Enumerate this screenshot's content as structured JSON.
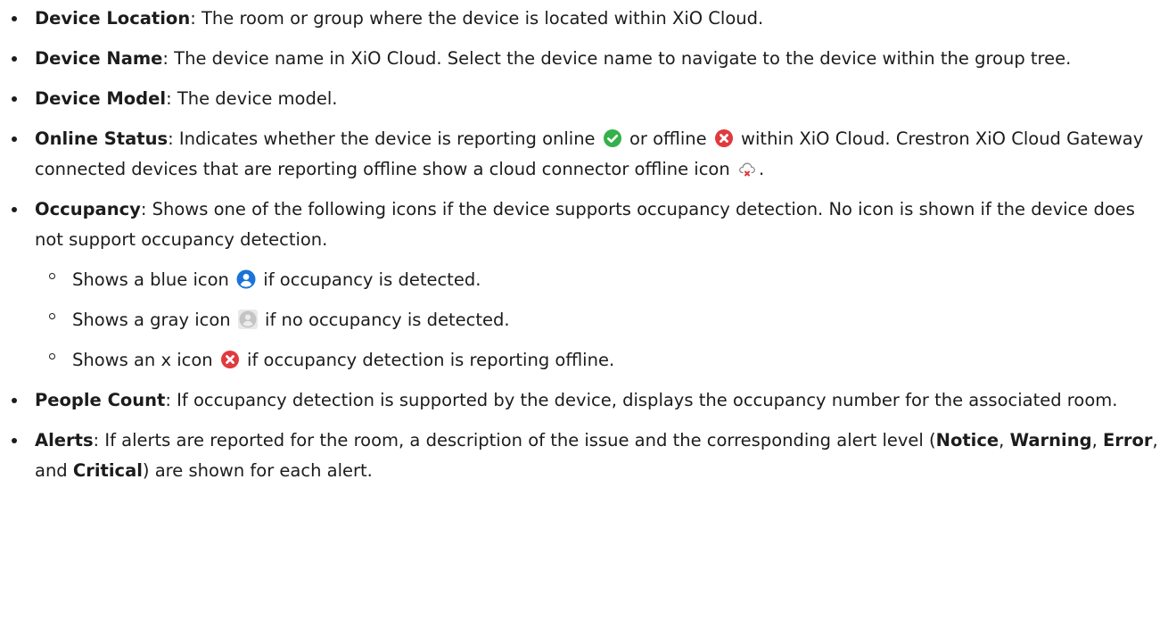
{
  "items": [
    {
      "term": "Device Location",
      "text": ": The room or group where the device is located within XiO Cloud."
    },
    {
      "term": "Device Name",
      "text": ": The device name in XiO Cloud. Select the device name to navigate to the device within the group tree."
    },
    {
      "term": "Device Model",
      "text": ": The device model."
    }
  ],
  "online_status": {
    "term": "Online Status",
    "text_a": ": Indicates whether the device is reporting online ",
    "text_b": " or offline ",
    "text_c": " within XiO Cloud. Crestron XiO Cloud Gateway connected devices that are reporting offline show a cloud connector offline icon ",
    "text_d": "."
  },
  "occupancy": {
    "term": "Occupancy",
    "text": ": Shows one of the following icons if the device supports occupancy detection. No icon is shown if the device does not support occupancy detection.",
    "sub": [
      {
        "pre": "Shows a blue icon ",
        "post": " if occupancy is detected."
      },
      {
        "pre": "Shows a gray icon ",
        "post": " if no occupancy is detected."
      },
      {
        "pre": "Shows an x icon ",
        "post": " if occupancy detection is reporting offline."
      }
    ]
  },
  "people_count": {
    "term": "People Count",
    "text": ": If occupancy detection is supported by the device, displays the occupancy number for the associated room."
  },
  "alerts": {
    "term": "Alerts",
    "text_a": ": If alerts are reported for the room, a description of the issue and the corresponding alert level (",
    "level_1": "Notice",
    "sep_1": ", ",
    "level_2": "Warning",
    "sep_2": ", ",
    "level_3": "Error",
    "sep_3": ", and ",
    "level_4": "Critical",
    "text_b": ") are shown for each alert."
  },
  "icons": {
    "online": "check-circle-icon",
    "offline": "x-circle-icon",
    "cloud_offline": "cloud-offline-icon",
    "occupied": "person-circle-blue-icon",
    "unoccupied": "person-circle-gray-icon"
  },
  "colors": {
    "online_green": "#35b14a",
    "offline_red": "#e0393e",
    "occupancy_blue": "#1a73d9",
    "occupancy_gray": "#c4c4c4"
  }
}
